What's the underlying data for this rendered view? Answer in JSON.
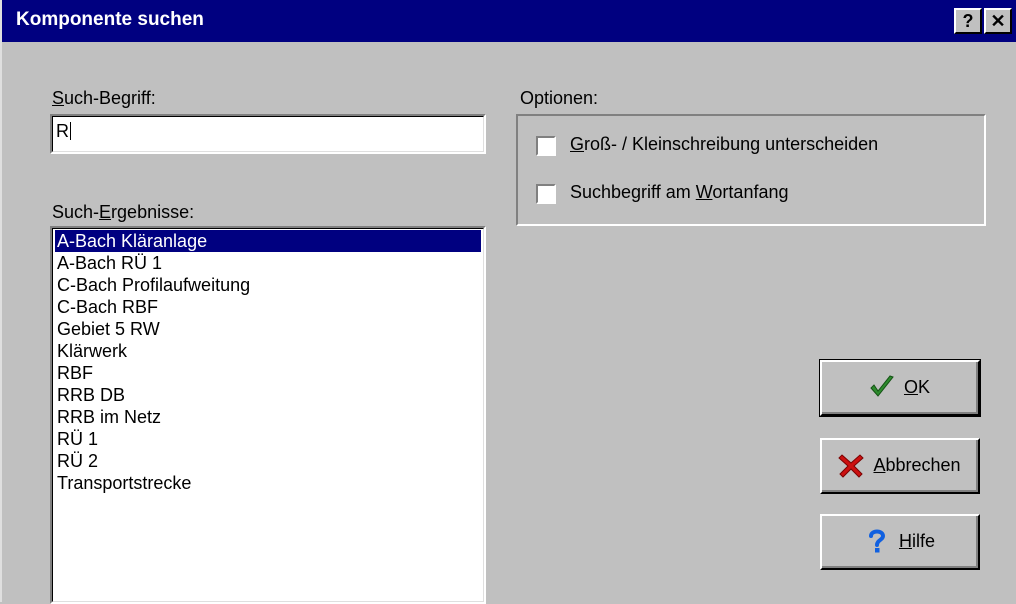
{
  "window": {
    "title": "Komponente suchen",
    "help_button": "?",
    "close_button": "✕"
  },
  "search": {
    "label_prefix": "S",
    "label_rest": "uch-Begriff:",
    "value": "R"
  },
  "results": {
    "label_before": "Such-",
    "label_accel": "E",
    "label_after": "rgebnisse:",
    "items": [
      "A-Bach Kläranlage",
      "A-Bach RÜ 1",
      "C-Bach Profilaufweitung",
      "C-Bach RBF",
      "Gebiet 5 RW",
      "Klärwerk",
      "RBF",
      "RRB DB",
      "RRB im Netz",
      "RÜ 1",
      "RÜ 2",
      "Transportstrecke"
    ],
    "selected_index": 0
  },
  "options": {
    "label": "Optionen:",
    "case_accel": "G",
    "case_rest": "roß- / Kleinschreibung unterscheiden",
    "case_checked": false,
    "start_before": "Suchbegriff am ",
    "start_accel": "W",
    "start_rest": "ortanfang",
    "start_checked": false
  },
  "buttons": {
    "ok_accel": "O",
    "ok_rest": "K",
    "cancel_accel": "A",
    "cancel_rest": "bbrechen",
    "help_accel": "H",
    "help_rest": "ilfe"
  },
  "colors": {
    "title_bar": "#000080",
    "selection": "#000080",
    "ok_icon": "#2e8b2e",
    "cancel_icon": "#cc1010",
    "help_icon": "#1060e0"
  },
  "icons": {
    "ok": "checkmark-icon",
    "cancel": "red-x-icon",
    "help": "question-mark-icon"
  }
}
